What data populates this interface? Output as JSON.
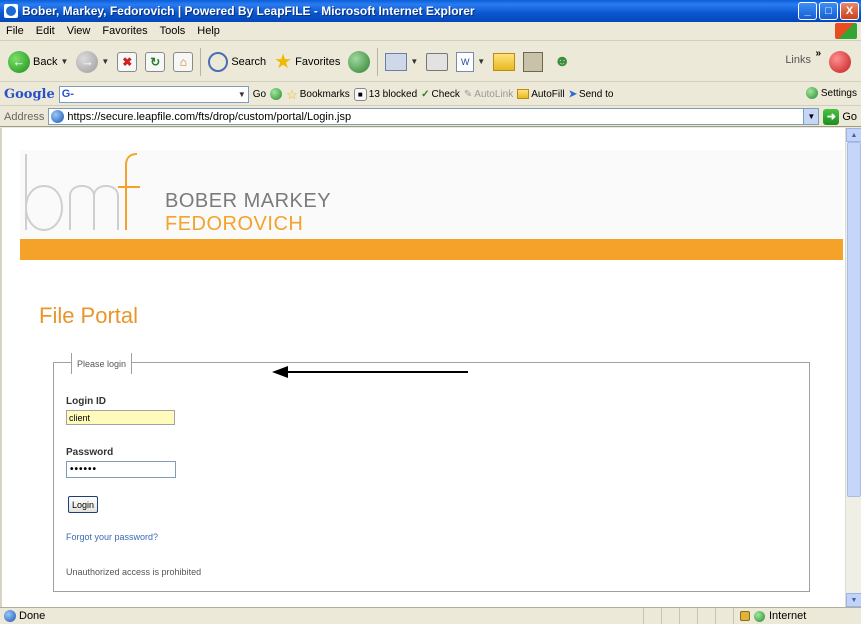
{
  "window": {
    "title": "Bober, Markey, Fedorovich | Powered By LeapFILE - Microsoft Internet Explorer",
    "minimize": "_",
    "maximize": "□",
    "close": "X"
  },
  "menu": [
    "File",
    "Edit",
    "View",
    "Favorites",
    "Tools",
    "Help"
  ],
  "toolbar": {
    "back_label": "Back",
    "search_label": "Search",
    "favorites_label": "Favorites",
    "links_label": "Links",
    "more_label": "»"
  },
  "google_toolbar": {
    "logo_g": "Google",
    "search_value": "G-",
    "go_label": "Go",
    "bookmarks_label": "Bookmarks",
    "blocked_label": "13 blocked",
    "check_label": "Check",
    "autolink_label": "AutoLink",
    "autofill_label": "AutoFill",
    "sendto_label": "Send to",
    "settings_label": "Settings"
  },
  "address_bar": {
    "label": "Address",
    "url": "https://secure.leapfile.com/fts/drop/custom/portal/Login.jsp",
    "go_label": "Go"
  },
  "page": {
    "logo_letters": "bmf",
    "company_line1": "BOBER MARKEY",
    "company_line2": "FEDOROVICH",
    "portal_title": "File Portal",
    "legend": "Please login",
    "login_id_label": "Login ID",
    "login_id_value": "client",
    "password_label": "Password",
    "password_value": "••••••",
    "login_button": "Login",
    "forgot_link": "Forgot your password?",
    "notice": "Unauthorized access is prohibited"
  },
  "status_bar": {
    "status_text": "Done",
    "zone_text": "Internet"
  },
  "colors": {
    "brand_orange": "#f4a22a",
    "brand_gray": "#7b7b7b",
    "input_highlight": "#fefbbd",
    "link_blue": "#3a6ab5"
  }
}
